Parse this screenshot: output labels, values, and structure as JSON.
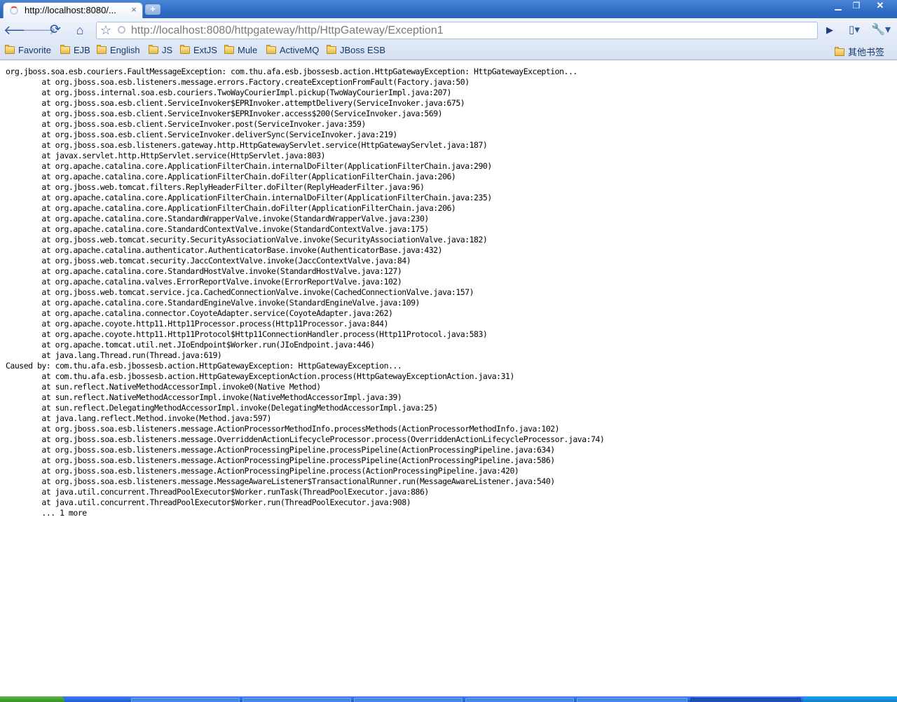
{
  "window": {
    "tab_title": "http://localhost:8080/...",
    "tab_close_glyph": "×",
    "new_tab_glyph": "+",
    "controls": {
      "minimize": "▁",
      "maximize": "❐",
      "close": "✕"
    }
  },
  "toolbar": {
    "url": "http://localhost:8080/httpgateway/http/HttpGateway/Exception1",
    "back_icon": "back-arrow-icon",
    "forward_icon": "forward-arrow-icon",
    "reload_icon": "reload-icon",
    "home_icon": "home-icon",
    "star_icon": "star-icon",
    "go_icon": "play-icon",
    "page_menu_icon": "page-icon",
    "tools_menu_icon": "wrench-icon"
  },
  "bookmarks": {
    "items": [
      {
        "label": "Favorite"
      },
      {
        "label": "EJB"
      },
      {
        "label": "English"
      },
      {
        "label": "JS"
      },
      {
        "label": "ExtJS"
      },
      {
        "label": "Mule"
      },
      {
        "label": "ActiveMQ"
      },
      {
        "label": "JBoss ESB"
      }
    ],
    "other": "其他书签"
  },
  "content": {
    "stack_trace": "org.jboss.soa.esb.couriers.FaultMessageException: com.thu.afa.esb.jbossesb.action.HttpGatewayException: HttpGatewayException...\n\tat org.jboss.soa.esb.listeners.message.errors.Factory.createExceptionFromFault(Factory.java:50)\n\tat org.jboss.internal.soa.esb.couriers.TwoWayCourierImpl.pickup(TwoWayCourierImpl.java:207)\n\tat org.jboss.soa.esb.client.ServiceInvoker$EPRInvoker.attemptDelivery(ServiceInvoker.java:675)\n\tat org.jboss.soa.esb.client.ServiceInvoker$EPRInvoker.access$200(ServiceInvoker.java:569)\n\tat org.jboss.soa.esb.client.ServiceInvoker.post(ServiceInvoker.java:359)\n\tat org.jboss.soa.esb.client.ServiceInvoker.deliverSync(ServiceInvoker.java:219)\n\tat org.jboss.soa.esb.listeners.gateway.http.HttpGatewayServlet.service(HttpGatewayServlet.java:187)\n\tat javax.servlet.http.HttpServlet.service(HttpServlet.java:803)\n\tat org.apache.catalina.core.ApplicationFilterChain.internalDoFilter(ApplicationFilterChain.java:290)\n\tat org.apache.catalina.core.ApplicationFilterChain.doFilter(ApplicationFilterChain.java:206)\n\tat org.jboss.web.tomcat.filters.ReplyHeaderFilter.doFilter(ReplyHeaderFilter.java:96)\n\tat org.apache.catalina.core.ApplicationFilterChain.internalDoFilter(ApplicationFilterChain.java:235)\n\tat org.apache.catalina.core.ApplicationFilterChain.doFilter(ApplicationFilterChain.java:206)\n\tat org.apache.catalina.core.StandardWrapperValve.invoke(StandardWrapperValve.java:230)\n\tat org.apache.catalina.core.StandardContextValve.invoke(StandardContextValve.java:175)\n\tat org.jboss.web.tomcat.security.SecurityAssociationValve.invoke(SecurityAssociationValve.java:182)\n\tat org.apache.catalina.authenticator.AuthenticatorBase.invoke(AuthenticatorBase.java:432)\n\tat org.jboss.web.tomcat.security.JaccContextValve.invoke(JaccContextValve.java:84)\n\tat org.apache.catalina.core.StandardHostValve.invoke(StandardHostValve.java:127)\n\tat org.apache.catalina.valves.ErrorReportValve.invoke(ErrorReportValve.java:102)\n\tat org.jboss.web.tomcat.service.jca.CachedConnectionValve.invoke(CachedConnectionValve.java:157)\n\tat org.apache.catalina.core.StandardEngineValve.invoke(StandardEngineValve.java:109)\n\tat org.apache.catalina.connector.CoyoteAdapter.service(CoyoteAdapter.java:262)\n\tat org.apache.coyote.http11.Http11Processor.process(Http11Processor.java:844)\n\tat org.apache.coyote.http11.Http11Protocol$Http11ConnectionHandler.process(Http11Protocol.java:583)\n\tat org.apache.tomcat.util.net.JIoEndpoint$Worker.run(JIoEndpoint.java:446)\n\tat java.lang.Thread.run(Thread.java:619)\nCaused by: com.thu.afa.esb.jbossesb.action.HttpGatewayException: HttpGatewayException...\n\tat com.thu.afa.esb.jbossesb.action.HttpGatewayExceptionAction.process(HttpGatewayExceptionAction.java:31)\n\tat sun.reflect.NativeMethodAccessorImpl.invoke0(Native Method)\n\tat sun.reflect.NativeMethodAccessorImpl.invoke(NativeMethodAccessorImpl.java:39)\n\tat sun.reflect.DelegatingMethodAccessorImpl.invoke(DelegatingMethodAccessorImpl.java:25)\n\tat java.lang.reflect.Method.invoke(Method.java:597)\n\tat org.jboss.soa.esb.listeners.message.ActionProcessorMethodInfo.processMethods(ActionProcessorMethodInfo.java:102)\n\tat org.jboss.soa.esb.listeners.message.OverriddenActionLifecycleProcessor.process(OverriddenActionLifecycleProcessor.java:74)\n\tat org.jboss.soa.esb.listeners.message.ActionProcessingPipeline.processPipeline(ActionProcessingPipeline.java:634)\n\tat org.jboss.soa.esb.listeners.message.ActionProcessingPipeline.processPipeline(ActionProcessingPipeline.java:586)\n\tat org.jboss.soa.esb.listeners.message.ActionProcessingPipeline.process(ActionProcessingPipeline.java:420)\n\tat org.jboss.soa.esb.listeners.message.MessageAwareListener$TransactionalRunner.run(MessageAwareListener.java:540)\n\tat java.util.concurrent.ThreadPoolExecutor$Worker.runTask(ThreadPoolExecutor.java:886)\n\tat java.util.concurrent.ThreadPoolExecutor$Worker.run(ThreadPoolExecutor.java:908)\n\t... 1 more"
  },
  "colors": {
    "chrome_blue": "#2f6cc4",
    "toolbar_bg": "#dfe8f6",
    "url_text": "#7a7a7a"
  }
}
